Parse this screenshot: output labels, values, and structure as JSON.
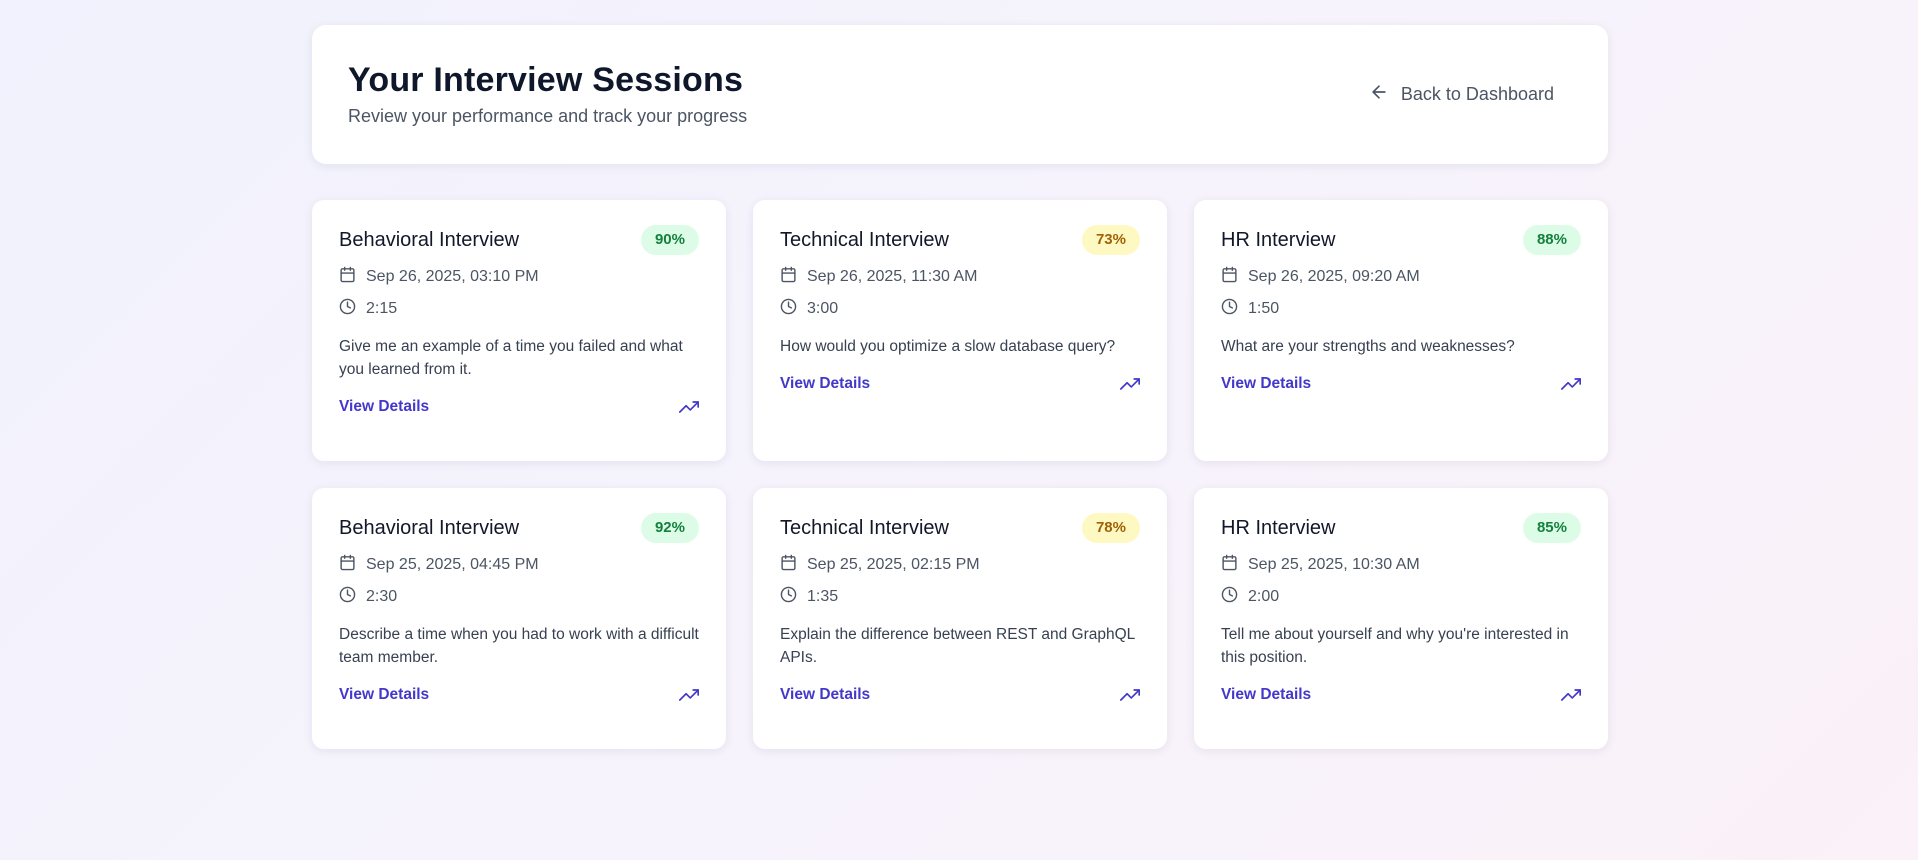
{
  "header": {
    "title": "Your Interview Sessions",
    "subtitle": "Review your performance and track your progress",
    "back_label": "Back to Dashboard"
  },
  "colors": {
    "accent": "#4338ca",
    "score_green_bg": "#dcfce7",
    "score_green_text": "#15803d",
    "score_yellow_bg": "#fef9c3",
    "score_yellow_text": "#a16207"
  },
  "sessions": [
    {
      "title": "Behavioral Interview",
      "score": "90%",
      "date": "Sep 26, 2025, 03:10 PM",
      "duration": "2:15",
      "question": "Give me an example of a time you failed and what you learned from it.",
      "link": "View Details"
    },
    {
      "title": "Technical Interview",
      "score": "73%",
      "date": "Sep 26, 2025, 11:30 AM",
      "duration": "3:00",
      "question": "How would you optimize a slow database query?",
      "link": "View Details"
    },
    {
      "title": "HR Interview",
      "score": "88%",
      "date": "Sep 26, 2025, 09:20 AM",
      "duration": "1:50",
      "question": "What are your strengths and weaknesses?",
      "link": "View Details"
    },
    {
      "title": "Behavioral Interview",
      "score": "92%",
      "date": "Sep 25, 2025, 04:45 PM",
      "duration": "2:30",
      "question": "Describe a time when you had to work with a difficult team member.",
      "link": "View Details"
    },
    {
      "title": "Technical Interview",
      "score": "78%",
      "date": "Sep 25, 2025, 02:15 PM",
      "duration": "1:35",
      "question": "Explain the difference between REST and GraphQL APIs.",
      "link": "View Details"
    },
    {
      "title": "HR Interview",
      "score": "85%",
      "date": "Sep 25, 2025, 10:30 AM",
      "duration": "2:00",
      "question": "Tell me about yourself and why you're interested in this position.",
      "link": "View Details"
    }
  ],
  "icons": {
    "back": "arrow-left-icon",
    "date": "calendar-icon",
    "duration": "clock-icon",
    "trend": "trending-up-icon"
  }
}
